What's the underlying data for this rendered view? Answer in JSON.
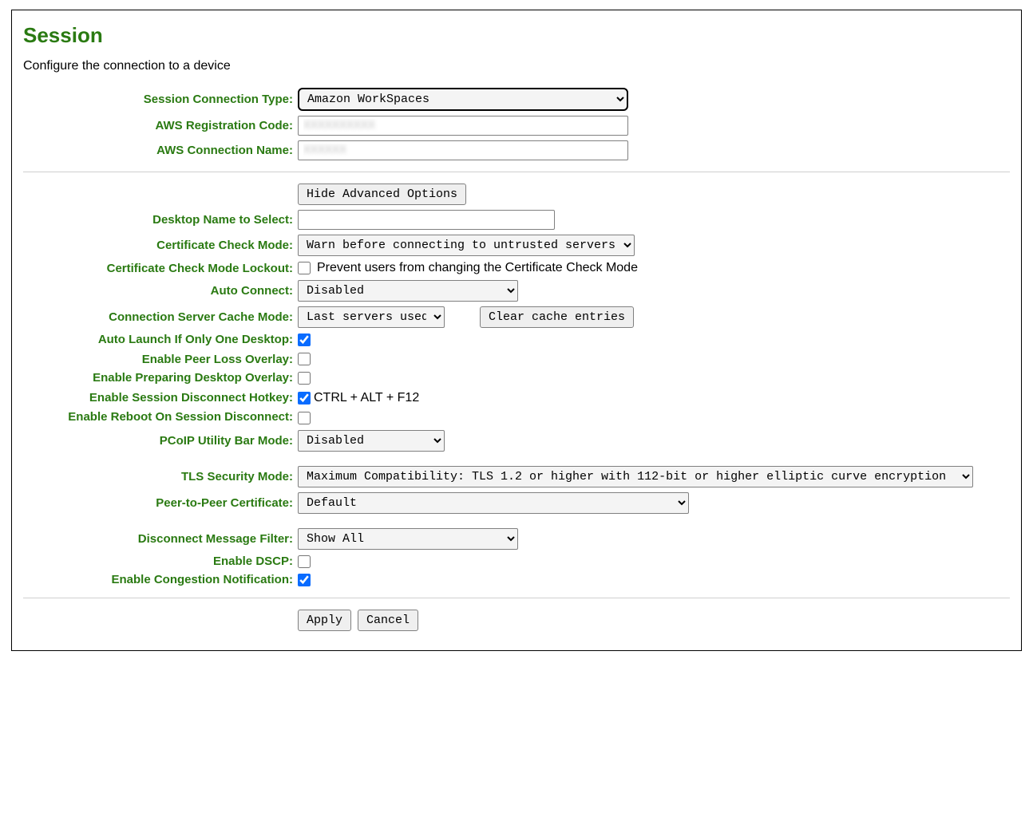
{
  "title": "Session",
  "description": "Configure the connection to a device",
  "fields": {
    "connType": {
      "label": "Session Connection Type:",
      "value": "Amazon WorkSpaces"
    },
    "regCode": {
      "label": "AWS Registration Code:",
      "value": "XXXXXXXXXX"
    },
    "connName": {
      "label": "AWS Connection Name:",
      "value": "XXXXXX"
    },
    "advBtn": "Hide Advanced Options",
    "desktopName": {
      "label": "Desktop Name to Select:",
      "value": ""
    },
    "certMode": {
      "label": "Certificate Check Mode:",
      "value": "Warn before connecting to untrusted servers"
    },
    "certLockout": {
      "label": "Certificate Check Mode Lockout:",
      "text": "Prevent users from changing the Certificate Check Mode",
      "checked": false
    },
    "autoConnect": {
      "label": "Auto Connect:",
      "value": "Disabled"
    },
    "cacheMode": {
      "label": "Connection Server Cache Mode:",
      "value": "Last servers used",
      "btn": "Clear cache entries"
    },
    "autoLaunch": {
      "label": "Auto Launch If Only One Desktop:",
      "checked": true
    },
    "peerLoss": {
      "label": "Enable Peer Loss Overlay:",
      "checked": false
    },
    "prepDesktop": {
      "label": "Enable Preparing Desktop Overlay:",
      "checked": false
    },
    "discHotkey": {
      "label": "Enable Session Disconnect Hotkey:",
      "text": "CTRL + ALT + F12",
      "checked": true
    },
    "rebootDisc": {
      "label": "Enable Reboot On Session Disconnect:",
      "checked": false
    },
    "utilBar": {
      "label": "PCoIP Utility Bar Mode:",
      "value": "Disabled"
    },
    "tlsMode": {
      "label": "TLS Security Mode:",
      "value": "Maximum Compatibility: TLS 1.2 or higher with 112-bit or higher elliptic curve encryption"
    },
    "p2pCert": {
      "label": "Peer-to-Peer Certificate:",
      "value": "Default"
    },
    "discFilter": {
      "label": "Disconnect Message Filter:",
      "value": "Show All"
    },
    "dscp": {
      "label": "Enable DSCP:",
      "checked": false
    },
    "congestion": {
      "label": "Enable Congestion Notification:",
      "checked": true
    }
  },
  "buttons": {
    "apply": "Apply",
    "cancel": "Cancel"
  }
}
